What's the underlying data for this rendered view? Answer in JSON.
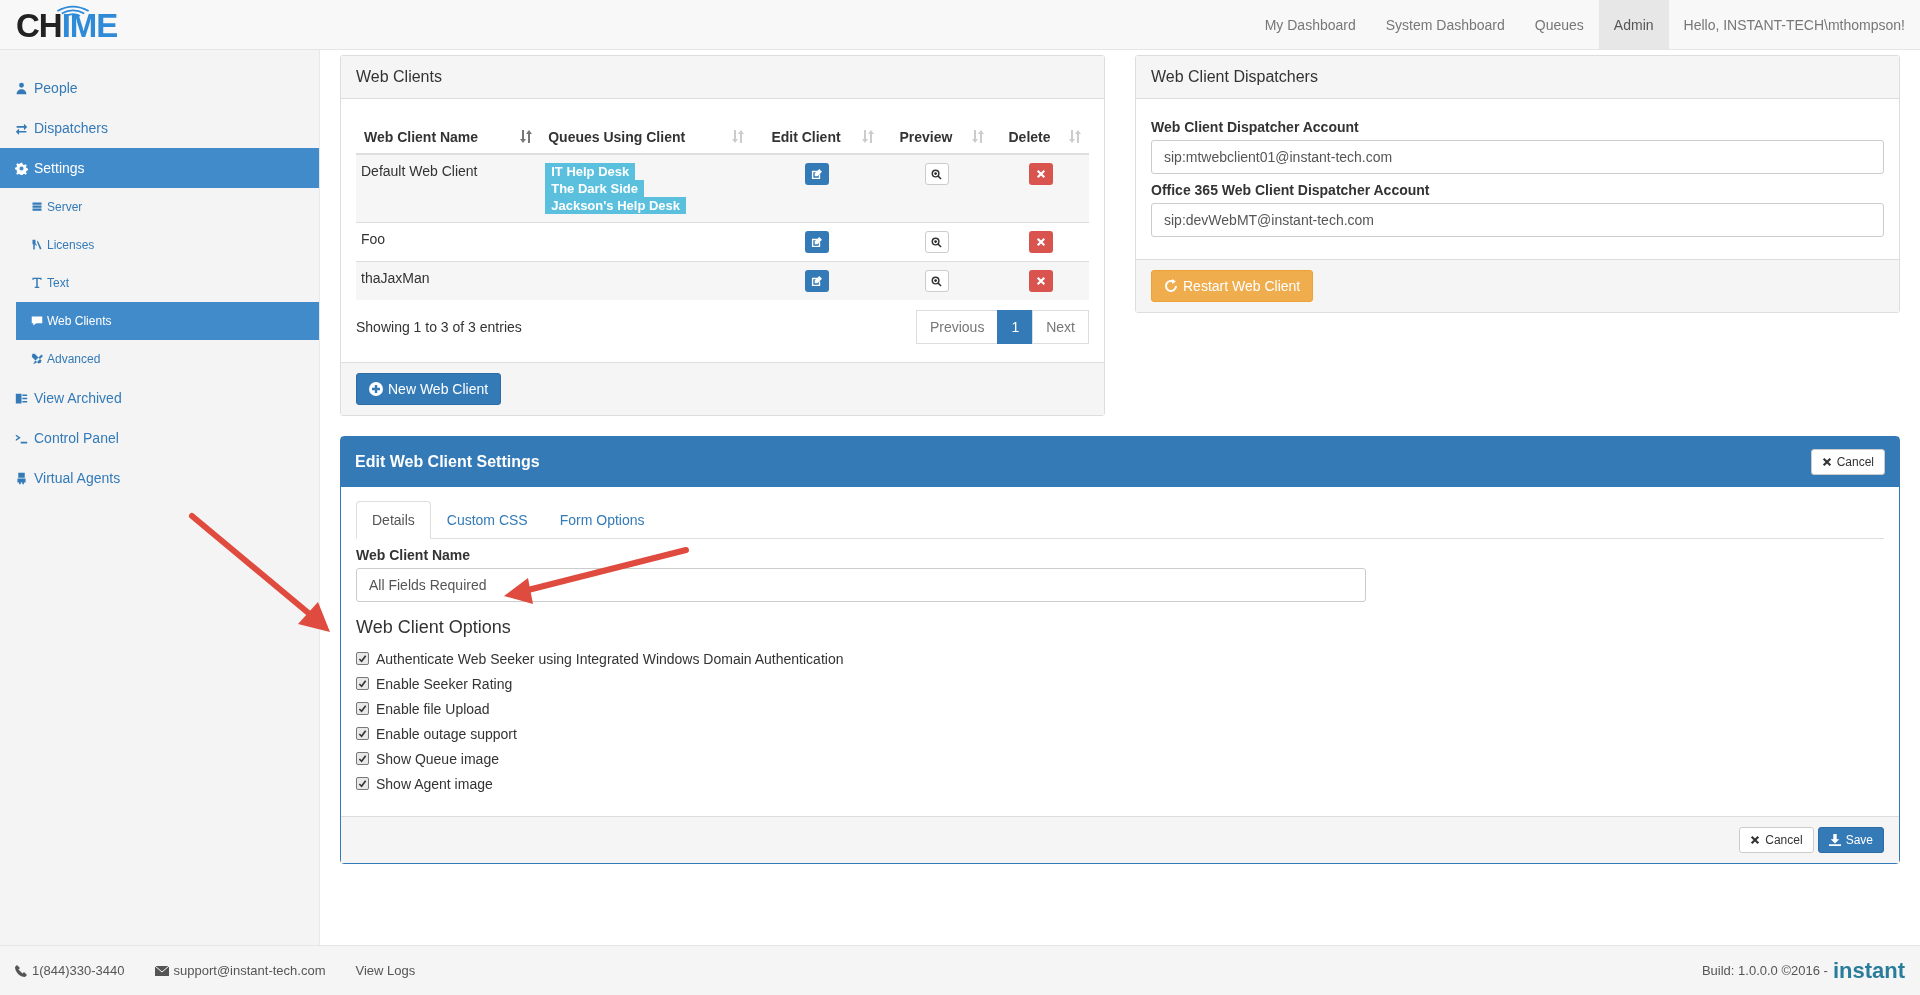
{
  "header": {
    "logo": {
      "dark": "CH",
      "accent": "IME"
    },
    "nav": [
      {
        "label": "My Dashboard",
        "selected": false
      },
      {
        "label": "System Dashboard",
        "selected": false
      },
      {
        "label": "Queues",
        "selected": false
      },
      {
        "label": "Admin",
        "selected": true
      }
    ],
    "greeting": "Hello, INSTANT-TECH\\mthompson!"
  },
  "sidebar": {
    "items": [
      {
        "label": "People",
        "selected": false
      },
      {
        "label": "Dispatchers",
        "selected": false
      },
      {
        "label": "Settings",
        "selected": true,
        "children": [
          {
            "label": "Server",
            "selected": false
          },
          {
            "label": "Licenses",
            "selected": false
          },
          {
            "label": "Text",
            "selected": false
          },
          {
            "label": "Web Clients",
            "selected": true
          },
          {
            "label": "Advanced",
            "selected": false
          }
        ]
      },
      {
        "label": "View Archived",
        "selected": false
      },
      {
        "label": "Control Panel",
        "selected": false
      },
      {
        "label": "Virtual Agents",
        "selected": false
      }
    ]
  },
  "web_clients": {
    "title": "Web Clients",
    "columns": [
      "Web Client Name",
      "Queues Using Client",
      "Edit Client",
      "Preview",
      "Delete"
    ],
    "rows": [
      {
        "name": "Default Web Client",
        "queues": [
          "IT Help Desk",
          "The Dark Side",
          "Jackson's Help Desk"
        ]
      },
      {
        "name": "Foo"
      },
      {
        "name": "thaJaxMan"
      }
    ],
    "info": "Showing 1 to 3 of 3 entries",
    "pagination": [
      {
        "label": "Previous",
        "selected": false
      },
      {
        "label": "1",
        "selected": true
      },
      {
        "label": "Next",
        "selected": false
      }
    ],
    "new_button": "New Web Client"
  },
  "dispatchers": {
    "title": "Web Client Dispatchers",
    "fields": [
      {
        "label": "Web Client Dispatcher Account",
        "value": "sip:mtwebclient01@instant-tech.com"
      },
      {
        "label": "Office 365 Web Client Dispatcher Account",
        "value": "sip:devWebMT@instant-tech.com"
      }
    ],
    "button": "Restart Web Client"
  },
  "edit": {
    "title": "Edit Web Client Settings",
    "cancel_top": "Cancel",
    "tabs": [
      {
        "label": "Details",
        "selected": true
      },
      {
        "label": "Custom CSS",
        "selected": false
      },
      {
        "label": "Form Options",
        "selected": false
      }
    ],
    "name_label": "Web Client Name",
    "name_value": "All Fields Required",
    "options_title": "Web Client Options",
    "options": [
      {
        "label": "Authenticate Web Seeker using Integrated Windows Domain Authentication",
        "checked": true
      },
      {
        "label": "Enable Seeker Rating",
        "checked": true
      },
      {
        "label": "Enable file Upload",
        "checked": true
      },
      {
        "label": "Enable outage support",
        "checked": true
      },
      {
        "label": "Show Queue image",
        "checked": true
      },
      {
        "label": "Show Agent image",
        "checked": true
      }
    ],
    "cancel": "Cancel",
    "save": "Save"
  },
  "footer": {
    "phone": "1(844)330-3440",
    "email": "support@instant-tech.com",
    "logs": "View Logs",
    "build": "Build: 1.0.0.0 ©2016 -",
    "brand": "instant"
  }
}
